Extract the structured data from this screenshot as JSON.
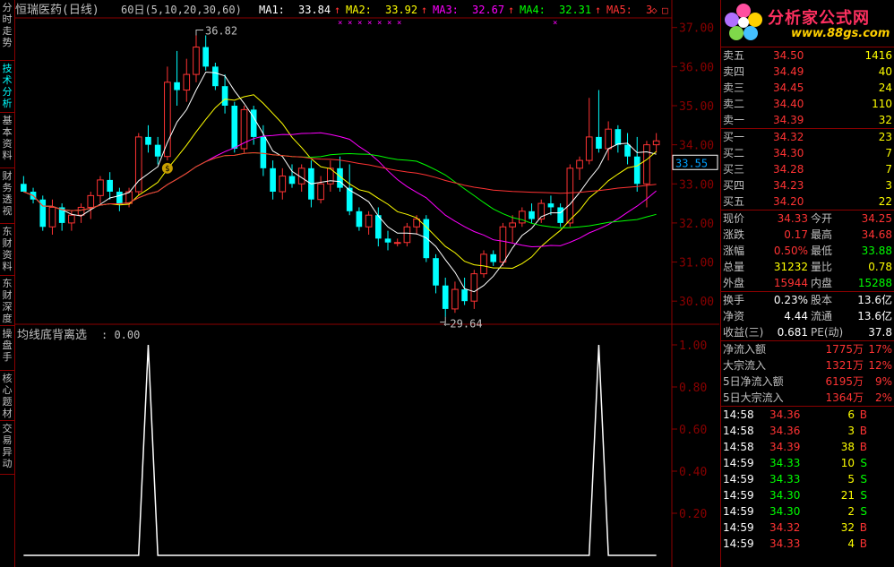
{
  "sidebar": {
    "tabs": [
      "分时走势",
      "技术分析",
      "基本资料",
      "财务透视",
      "东财资料",
      "东财深度",
      "操盘手",
      "核心题材",
      "交易异动"
    ]
  },
  "header": {
    "stock_name": "恒瑞医药",
    "period": "(日线)",
    "ma_param": "60日(5,10,20,30,60)",
    "ma": [
      {
        "label": "MA1:",
        "value": "33.84",
        "color": "#ffffff"
      },
      {
        "label": "MA2:",
        "value": "33.92",
        "color": "#ffff00"
      },
      {
        "label": "MA3:",
        "value": "32.67",
        "color": "#ff00ff"
      },
      {
        "label": "MA4:",
        "value": "32.31",
        "color": "#00ff00"
      },
      {
        "label": "MA5:",
        "value": "3",
        "color": "#ff3333"
      }
    ]
  },
  "price_chart": {
    "y_ticks": [
      "37.00",
      "36.00",
      "35.00",
      "34.00",
      "33.00",
      "32.00",
      "31.00",
      "30.00"
    ],
    "y_range": [
      29.5,
      37.2
    ],
    "current_price": "33.55",
    "high_label": "36.82",
    "low_label": "29.64",
    "candles": [
      [
        33.0,
        33.2,
        32.8,
        32.8
      ],
      [
        32.8,
        32.9,
        32.5,
        32.6
      ],
      [
        32.6,
        32.7,
        31.8,
        31.9
      ],
      [
        31.9,
        32.6,
        31.7,
        32.4
      ],
      [
        32.4,
        32.5,
        31.8,
        32.0
      ],
      [
        32.0,
        32.3,
        31.8,
        32.2
      ],
      [
        32.2,
        32.5,
        32.0,
        32.4
      ],
      [
        32.4,
        32.8,
        32.1,
        32.7
      ],
      [
        32.7,
        33.2,
        32.5,
        33.1
      ],
      [
        33.1,
        33.3,
        32.6,
        32.8
      ],
      [
        32.8,
        32.9,
        32.3,
        32.5
      ],
      [
        32.5,
        32.9,
        32.4,
        32.8
      ],
      [
        32.8,
        34.3,
        32.7,
        34.2
      ],
      [
        34.2,
        34.5,
        33.8,
        34.0
      ],
      [
        34.0,
        34.2,
        33.5,
        33.7
      ],
      [
        33.7,
        36.0,
        33.6,
        35.6
      ],
      [
        35.6,
        36.4,
        35.0,
        35.4
      ],
      [
        35.4,
        36.2,
        35.1,
        35.8
      ],
      [
        35.8,
        36.8,
        35.6,
        36.5
      ],
      [
        36.5,
        36.8,
        35.9,
        36.0
      ],
      [
        36.0,
        36.1,
        35.4,
        35.5
      ],
      [
        35.5,
        35.8,
        34.8,
        35.0
      ],
      [
        35.0,
        35.1,
        33.8,
        33.9
      ],
      [
        33.9,
        35.0,
        33.8,
        34.9
      ],
      [
        34.9,
        35.0,
        34.0,
        34.2
      ],
      [
        34.2,
        34.5,
        33.2,
        33.4
      ],
      [
        33.4,
        33.6,
        32.6,
        32.8
      ],
      [
        32.8,
        33.4,
        32.6,
        33.2
      ],
      [
        33.2,
        33.5,
        32.9,
        33.0
      ],
      [
        33.0,
        33.5,
        32.8,
        33.4
      ],
      [
        33.4,
        33.6,
        32.4,
        32.6
      ],
      [
        32.6,
        33.2,
        32.5,
        33.0
      ],
      [
        33.0,
        33.6,
        32.8,
        33.4
      ],
      [
        33.4,
        33.7,
        32.8,
        32.9
      ],
      [
        32.9,
        33.5,
        32.2,
        32.3
      ],
      [
        32.3,
        32.4,
        31.8,
        31.9
      ],
      [
        31.9,
        32.3,
        31.7,
        32.2
      ],
      [
        32.2,
        32.4,
        31.4,
        31.6
      ],
      [
        31.6,
        31.8,
        31.3,
        31.5
      ],
      [
        31.5,
        31.6,
        31.4,
        31.5
      ],
      [
        31.5,
        32.0,
        31.4,
        31.9
      ],
      [
        31.9,
        32.2,
        31.7,
        32.1
      ],
      [
        32.1,
        32.2,
        31.0,
        31.1
      ],
      [
        31.1,
        31.2,
        30.2,
        30.4
      ],
      [
        30.4,
        30.6,
        29.6,
        29.8
      ],
      [
        29.8,
        30.5,
        29.7,
        30.3
      ],
      [
        30.3,
        30.6,
        29.9,
        30.0
      ],
      [
        30.0,
        30.8,
        29.8,
        30.7
      ],
      [
        30.7,
        31.3,
        30.6,
        31.2
      ],
      [
        31.2,
        31.3,
        30.9,
        31.0
      ],
      [
        31.0,
        32.0,
        30.9,
        31.9
      ],
      [
        31.9,
        32.2,
        31.5,
        32.0
      ],
      [
        32.0,
        32.4,
        31.9,
        32.3
      ],
      [
        32.3,
        32.5,
        32.0,
        32.1
      ],
      [
        32.1,
        32.6,
        32.0,
        32.5
      ],
      [
        32.5,
        32.7,
        32.2,
        32.4
      ],
      [
        32.4,
        32.5,
        31.9,
        32.0
      ],
      [
        32.0,
        33.5,
        31.9,
        33.4
      ],
      [
        33.4,
        33.7,
        33.1,
        33.6
      ],
      [
        33.6,
        35.2,
        33.5,
        34.2
      ],
      [
        34.2,
        35.4,
        33.8,
        33.9
      ],
      [
        33.9,
        34.6,
        33.6,
        34.4
      ],
      [
        34.4,
        34.5,
        33.8,
        34.0
      ],
      [
        34.0,
        34.3,
        33.5,
        33.7
      ],
      [
        33.7,
        34.2,
        32.8,
        33.0
      ],
      [
        33.0,
        34.1,
        32.4,
        34.0
      ],
      [
        34.0,
        34.3,
        33.8,
        34.1
      ]
    ]
  },
  "indicator": {
    "title": "均线底背离选",
    "value": "0.00",
    "y_ticks": [
      "1.00",
      "0.80",
      "0.60",
      "0.40",
      "0.20"
    ],
    "spikes_at": [
      13,
      60
    ],
    "count": 67
  },
  "quote": {
    "logo_title": "分析家公式网",
    "logo_url": "www.88gs.com",
    "asks": [
      {
        "label": "卖五",
        "price": "34.50",
        "vol": "1416"
      },
      {
        "label": "卖四",
        "price": "34.49",
        "vol": "40"
      },
      {
        "label": "卖三",
        "price": "34.45",
        "vol": "24"
      },
      {
        "label": "卖二",
        "price": "34.40",
        "vol": "110"
      },
      {
        "label": "卖一",
        "price": "34.39",
        "vol": "32"
      }
    ],
    "bids": [
      {
        "label": "买一",
        "price": "34.32",
        "vol": "23"
      },
      {
        "label": "买二",
        "price": "34.30",
        "vol": "7"
      },
      {
        "label": "买三",
        "price": "34.28",
        "vol": "7"
      },
      {
        "label": "买四",
        "price": "34.23",
        "vol": "3"
      },
      {
        "label": "买五",
        "price": "34.20",
        "vol": "22"
      }
    ],
    "stats": [
      {
        "l1": "现价",
        "v1": "34.33",
        "c1": "red",
        "l2": "今开",
        "v2": "34.25",
        "c2": "red"
      },
      {
        "l1": "涨跌",
        "v1": "0.17",
        "c1": "red",
        "l2": "最高",
        "v2": "34.68",
        "c2": "red"
      },
      {
        "l1": "涨幅",
        "v1": "0.50%",
        "c1": "red",
        "l2": "最低",
        "v2": "33.88",
        "c2": "green"
      },
      {
        "l1": "总量",
        "v1": "31232",
        "c1": "yellow",
        "l2": "量比",
        "v2": "0.78",
        "c2": "yellow"
      },
      {
        "l1": "外盘",
        "v1": "15944",
        "c1": "red",
        "l2": "内盘",
        "v2": "15288",
        "c2": "green"
      }
    ],
    "stats2": [
      {
        "l1": "换手",
        "v1": "0.23%",
        "l2": "股本",
        "v2": "13.6亿"
      },
      {
        "l1": "净资",
        "v1": "4.44",
        "l2": "流通",
        "v2": "13.6亿"
      },
      {
        "l1": "收益(三)",
        "v1": "0.681",
        "l2": "PE(动)",
        "v2": "37.8"
      }
    ],
    "flows": [
      {
        "label": "净流入额",
        "value": "1775万",
        "pct": "17%",
        "color": "red"
      },
      {
        "label": "大宗流入",
        "value": "1321万",
        "pct": "12%",
        "color": "red"
      },
      {
        "label": "5日净流入额",
        "value": "6195万",
        "pct": "9%",
        "color": "red"
      },
      {
        "label": "5日大宗流入",
        "value": "1364万",
        "pct": "2%",
        "color": "red"
      }
    ],
    "ticks": [
      {
        "time": "14:58",
        "price": "34.36",
        "vol": "6",
        "side": "B"
      },
      {
        "time": "14:58",
        "price": "34.36",
        "vol": "3",
        "side": "B"
      },
      {
        "time": "14:58",
        "price": "34.39",
        "vol": "38",
        "side": "B"
      },
      {
        "time": "14:59",
        "price": "34.33",
        "vol": "10",
        "side": "S"
      },
      {
        "time": "14:59",
        "price": "34.33",
        "vol": "5",
        "side": "S"
      },
      {
        "time": "14:59",
        "price": "34.30",
        "vol": "21",
        "side": "S"
      },
      {
        "time": "14:59",
        "price": "34.30",
        "vol": "2",
        "side": "S"
      },
      {
        "time": "14:59",
        "price": "34.32",
        "vol": "32",
        "side": "B"
      },
      {
        "time": "14:59",
        "price": "34.33",
        "vol": "4",
        "side": "B"
      }
    ]
  }
}
